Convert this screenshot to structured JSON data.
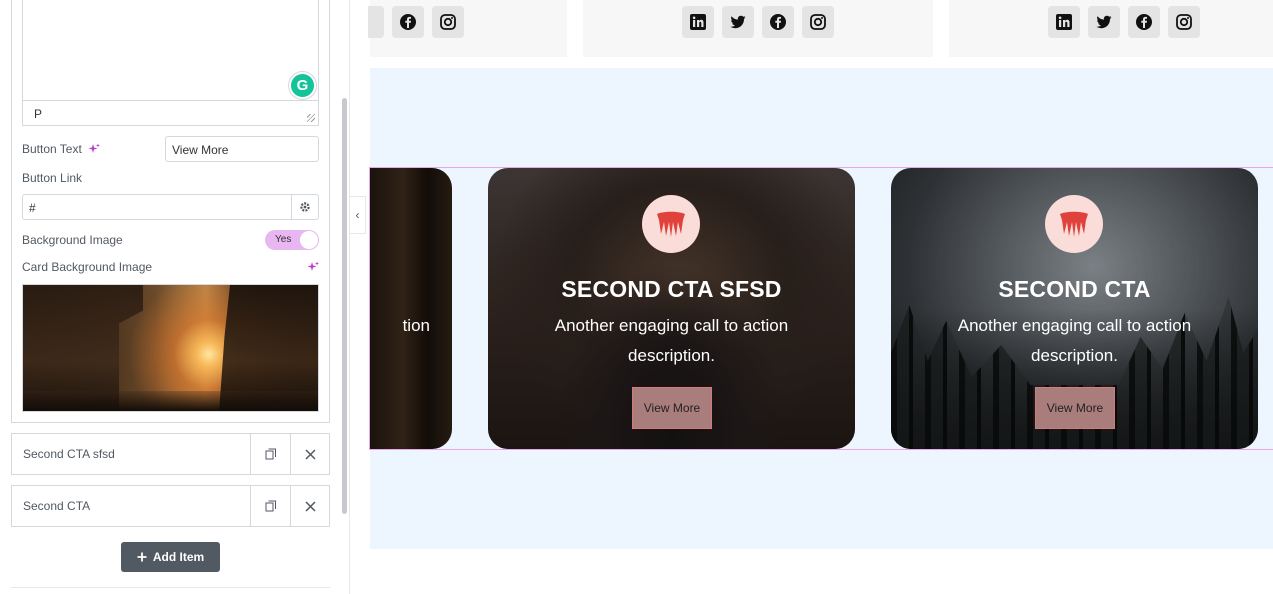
{
  "editor": {
    "path_text": "P",
    "button_text_label": "Button Text",
    "button_text_value": "View More",
    "button_link_label": "Button Link",
    "button_link_value": "#",
    "bg_image_label": "Background Image",
    "bg_image_toggle": "Yes",
    "card_bg_image_label": "Card Background Image",
    "items": [
      {
        "title": "Second CTA sfsd"
      },
      {
        "title": "Second CTA"
      }
    ],
    "add_item_label": "Add Item"
  },
  "preview": {
    "partial_card_text": "tion",
    "cards": [
      {
        "title": "SECOND CTA SFSD",
        "description": "Another engaging call to action description.",
        "button": "View More"
      },
      {
        "title": "SECOND CTA",
        "description": "Another engaging call to action description.",
        "button": "View More"
      }
    ]
  },
  "colors": {
    "accent_pink": "#e8b6f0",
    "section_bg": "#edf6ff",
    "cta_button": "#a87d7c",
    "logo_red": "#e0413b"
  },
  "icons": {
    "social": [
      "linkedin-icon",
      "twitter-icon",
      "facebook-icon",
      "instagram-icon"
    ],
    "row_actions": [
      "duplicate-icon",
      "close-icon"
    ]
  }
}
